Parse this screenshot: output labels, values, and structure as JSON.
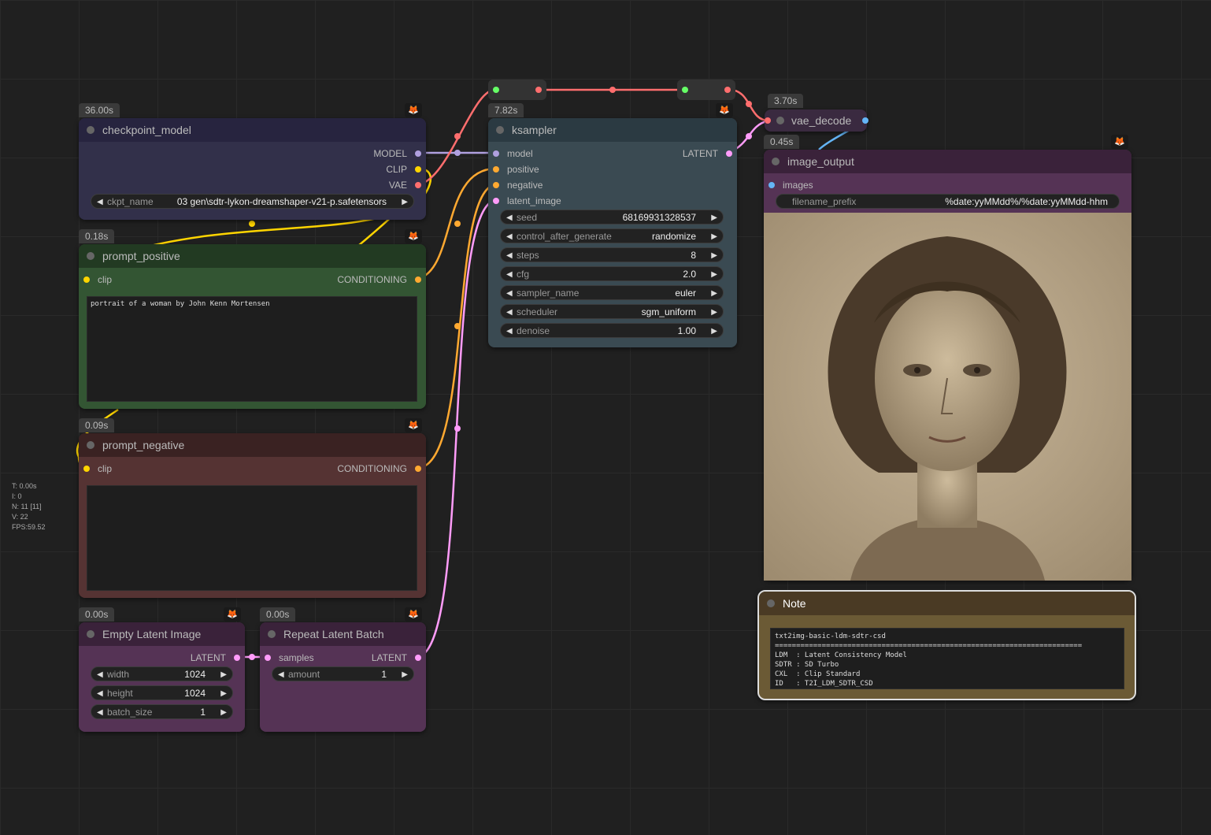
{
  "stats": {
    "t": "T: 0.00s",
    "i": "I: 0",
    "n": "N: 11 [11]",
    "v": "V: 22",
    "fps": "FPS:59.52"
  },
  "fox_glyph": "🦊",
  "colors": {
    "model": "#b0a0e0",
    "clip": "#ffd500",
    "vae": "#ff6e6e",
    "conditioning": "#ffa931",
    "latent": "#ff9cf9",
    "image": "#64b5f6",
    "background": "#202020"
  },
  "checkpoint": {
    "time": "36.00s",
    "title": "checkpoint_model",
    "out_model": "MODEL",
    "out_clip": "CLIP",
    "out_vae": "VAE",
    "ckpt_label": "ckpt_name",
    "ckpt_value": "03 gen\\sdtr-lykon-dreamshaper-v21-p.safetensors"
  },
  "positive": {
    "time": "0.18s",
    "title": "prompt_positive",
    "in_clip": "clip",
    "out": "CONDITIONING",
    "text": "portrait of a woman by John Kenn Mortensen"
  },
  "negative": {
    "time": "0.09s",
    "title": "prompt_negative",
    "in_clip": "clip",
    "out": "CONDITIONING",
    "text": ""
  },
  "empty_latent": {
    "time": "0.00s",
    "title": "Empty Latent Image",
    "out": "LATENT",
    "width_label": "width",
    "width": "1024",
    "height_label": "height",
    "height": "1024",
    "batch_label": "batch_size",
    "batch": "1"
  },
  "repeat": {
    "time": "0.00s",
    "title": "Repeat Latent Batch",
    "in": "samples",
    "out": "LATENT",
    "amount_label": "amount",
    "amount": "1"
  },
  "ksampler": {
    "time": "7.82s",
    "title": "ksampler",
    "in_model": "model",
    "in_positive": "positive",
    "in_negative": "negative",
    "in_latent": "latent_image",
    "out": "LATENT",
    "widgets": [
      {
        "label": "seed",
        "value": "68169931328537"
      },
      {
        "label": "control_after_generate",
        "value": "randomize"
      },
      {
        "label": "steps",
        "value": "8"
      },
      {
        "label": "cfg",
        "value": "2.0"
      },
      {
        "label": "sampler_name",
        "value": "euler"
      },
      {
        "label": "scheduler",
        "value": "sgm_uniform"
      },
      {
        "label": "denoise",
        "value": "1.00"
      }
    ]
  },
  "vae_decode": {
    "time": "3.70s",
    "title": "vae_decode"
  },
  "image_output": {
    "time": "0.45s",
    "title": "image_output",
    "in_images": "images",
    "prefix_label": "filename_prefix",
    "prefix_value": "%date:yyMMdd%/%date:yyMMdd-hhm"
  },
  "note": {
    "title": "Note",
    "text": "txt2img-basic-ldm-sdtr-csd\n========================================================================\nLDM  : Latent Consistency Model\nSDTR : SD Turbo\nCXL  : Clip Standard\nID   : T2I_LDM_SDTR_CSD"
  }
}
